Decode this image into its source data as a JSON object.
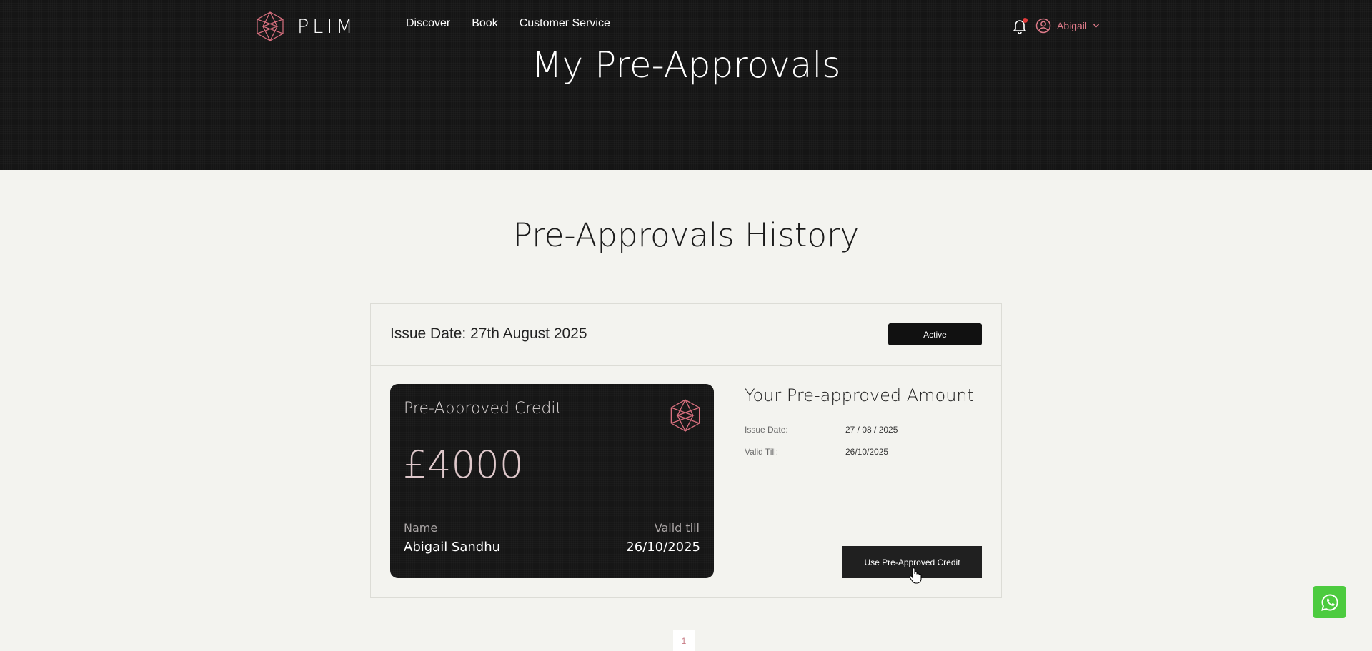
{
  "header": {
    "brand": "PLIM",
    "nav": [
      {
        "label": "Discover"
      },
      {
        "label": "Book"
      },
      {
        "label": "Customer Service"
      }
    ],
    "user_name": "Abigail",
    "page_title": "My Pre-Approvals"
  },
  "main": {
    "section_title": "Pre-Approvals History",
    "entry": {
      "issue_date": "Issue Date: 27th August 2025",
      "status": "Active",
      "card": {
        "title": "Pre-Approved Credit",
        "amount": "£4000",
        "name_label": "Name",
        "name_value": "Abigail Sandhu",
        "valid_label": "Valid till",
        "valid_value": "26/10/2025"
      },
      "details": {
        "title": "Your Pre-approved Amount",
        "issue_label": "Issue Date:",
        "issue_value": "27 / 08 / 2025",
        "valid_label": "Valid Till:",
        "valid_value": "26/10/2025"
      },
      "use_button": "Use Pre-Approved Credit"
    },
    "pagination": {
      "current": "1"
    }
  },
  "colors": {
    "header_bg": "#151515",
    "page_bg": "#f3f3ef",
    "accent_pink": "#e07b8a",
    "whatsapp_green": "#4ccb3f"
  },
  "icons": [
    "plim-logo-icon",
    "bell-icon",
    "user-circle-icon",
    "chevron-down-icon",
    "whatsapp-icon"
  ]
}
